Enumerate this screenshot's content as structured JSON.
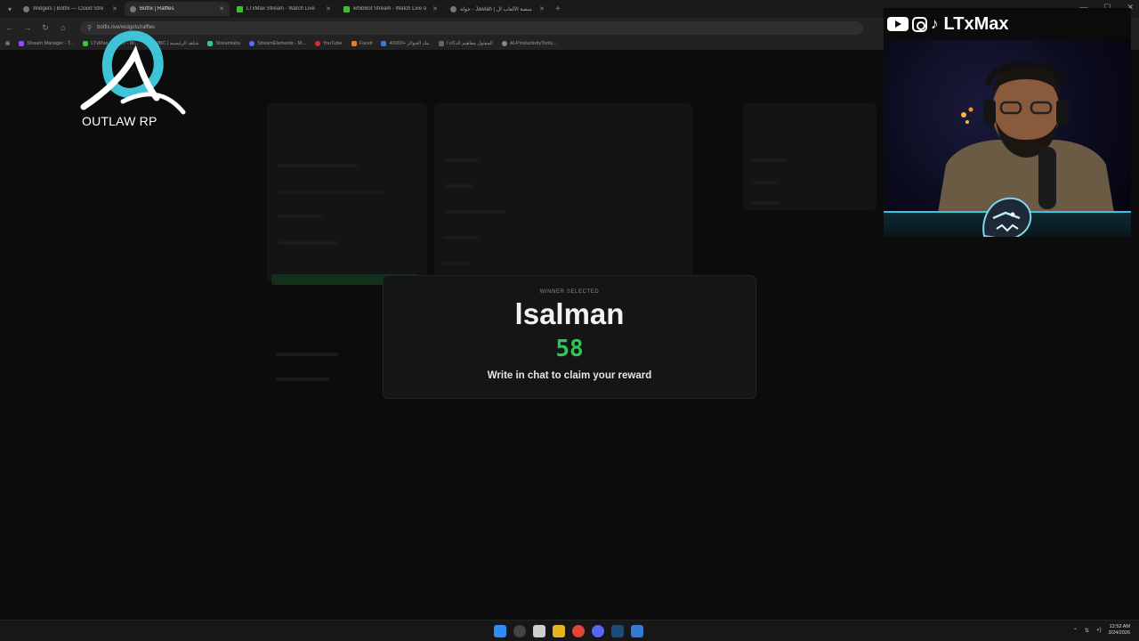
{
  "browser": {
    "tabs": [
      {
        "title": "Widgets | Botfix — Cloud Stre",
        "active": false,
        "icon": "globe-icon"
      },
      {
        "title": "Botfix | Raffles",
        "active": true,
        "icon": "globe-icon"
      },
      {
        "title": "LTxMax Stream - Watch Live",
        "active": false,
        "icon": "kick-icon"
      },
      {
        "title": "whibBot Stream - Watch Live o",
        "active": false,
        "icon": "kick-icon"
      },
      {
        "title": "جولة - Jawlah | منصة الألعاب ال",
        "active": false,
        "icon": "globe-icon"
      }
    ],
    "url": "botfix.live/widgets/raffles",
    "bookmarks": [
      "Stream Manager - T...",
      "LTxMax Stream - W...",
      "MBC | شاهد الرئيسية",
      "Streamlabs",
      "StreamElements - M...",
      "YouTube",
      "Faceit",
      "40000+ بنك الجوائز",
      "المفتول مفاهيم الذكاء ا",
      "AI-ProductivityTools..."
    ]
  },
  "overlay": {
    "logo_text": "OUTLAW RP",
    "social_handle": "LTxMax"
  },
  "winner": {
    "label": "WINNER SELECTED",
    "name": "lsalman",
    "countdown": "58",
    "message": "Write in chat to claim your reward"
  },
  "taskbar": {
    "time": "12:52 AM",
    "date": "3/24/2026"
  },
  "colors": {
    "accent_green": "#2ec55a",
    "cam_frame": "#38c6e6",
    "logo_teal": "#3ec4d6"
  }
}
